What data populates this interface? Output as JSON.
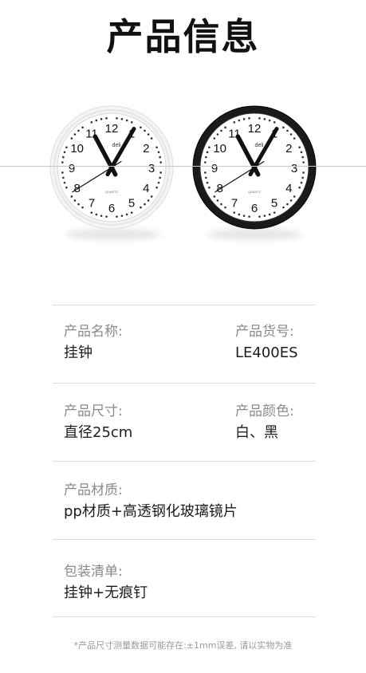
{
  "title": "产品信息",
  "clocks": [
    {
      "name": "white",
      "frame_color": "#f4f4f4",
      "brand": "deli",
      "sub": "QUARTZ"
    },
    {
      "name": "black",
      "frame_color": "#1a1a1a",
      "brand": "deli",
      "sub": "QUARTZ"
    }
  ],
  "dial_numbers": [
    "12",
    "1",
    "2",
    "3",
    "4",
    "5",
    "6",
    "7",
    "8",
    "9",
    "10",
    "11"
  ],
  "specs": {
    "name": {
      "label": "产品名称:",
      "value": "挂钟"
    },
    "sku": {
      "label": "产品货号:",
      "value": "LE400ES"
    },
    "size": {
      "label": "产品尺寸:",
      "value": "直径25cm"
    },
    "color": {
      "label": "产品颜色:",
      "value": "白、黑"
    },
    "material": {
      "label": "产品材质:",
      "value": "pp材质+高透钢化玻璃镜片"
    },
    "package": {
      "label": "包装清单:",
      "value": "挂钟+无痕钉"
    }
  },
  "footnote": "*产品尺寸测量数据可能存在:±1mm误差, 请以实物为准"
}
